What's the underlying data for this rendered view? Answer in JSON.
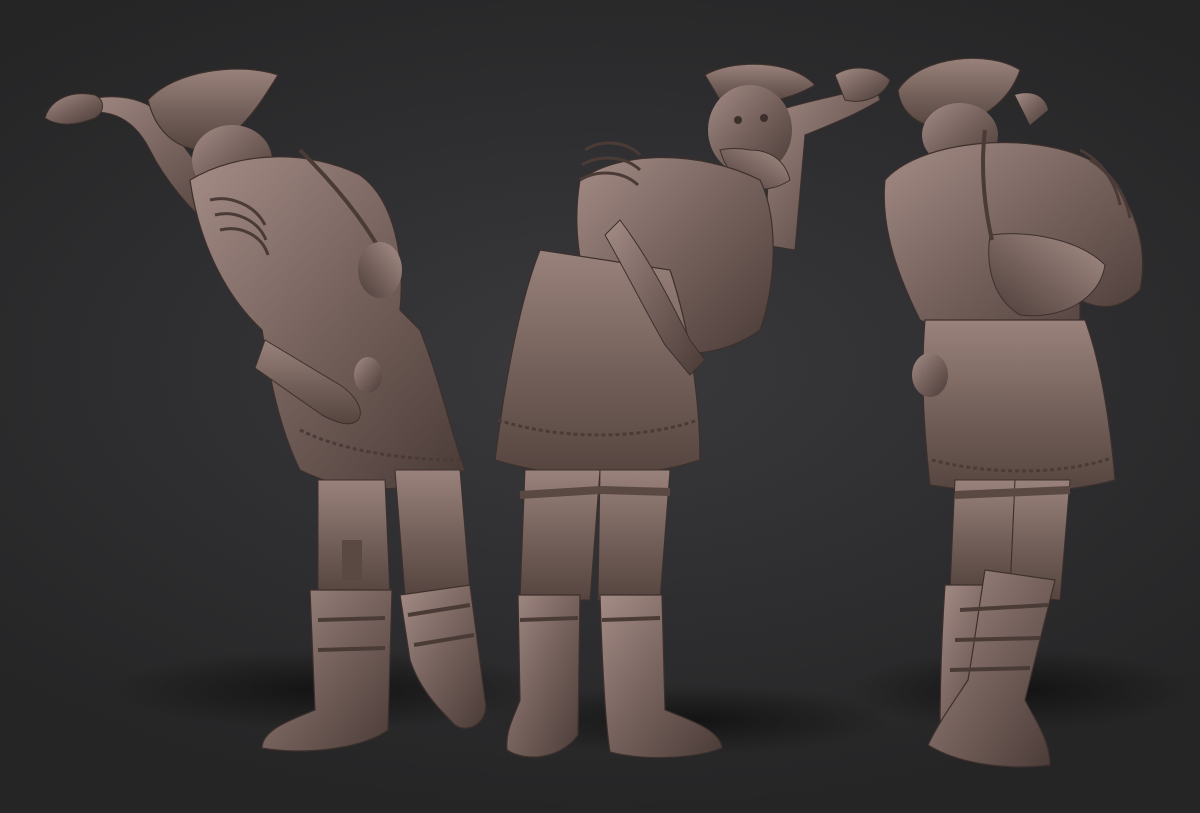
{
  "scene": {
    "kind": "3d-sculpt-turnaround",
    "figure_count": 3,
    "views": [
      "back-left-three-quarter",
      "front-leaning",
      "back"
    ],
    "colors": {
      "background": "#2c2c2d",
      "clay_base": "#7a6560",
      "clay_light": "#a48c86",
      "clay_dark": "#4a3b37",
      "shadow": "#1a1a1a"
    }
  }
}
